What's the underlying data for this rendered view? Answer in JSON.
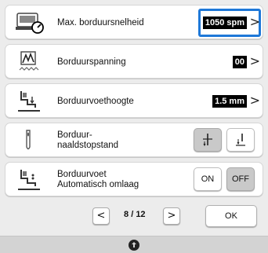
{
  "settings": [
    {
      "label": "Max. borduursnelheid",
      "value": "1050 spm",
      "icon": "max-speed-icon",
      "highlighted": true
    },
    {
      "label": "Borduurspanning",
      "value": "00",
      "icon": "tension-icon"
    },
    {
      "label": "Borduurvoethoogte",
      "value": "1.5 mm",
      "icon": "foot-height-icon"
    },
    {
      "label_line1": "Borduur-",
      "label_line2": "naaldstopstand",
      "icon": "needle-icon",
      "options": [
        "needle-down-icon",
        "needle-up-icon"
      ],
      "selected": 0
    },
    {
      "label_line1": "Borduurvoet",
      "label_line2": "Automatisch omlaag",
      "icon": "presser-foot-icon",
      "options": [
        "ON",
        "OFF"
      ],
      "selected": 1
    }
  ],
  "pager": {
    "current": "8",
    "separator": "/",
    "total": "12",
    "prev": "<",
    "next": ">"
  },
  "ok_label": "OK",
  "chevron": ">",
  "footer_icon": "sewing-machine-icon",
  "colors": {
    "highlight": "#1e78d8",
    "selected_button": "#c9c9c9"
  }
}
